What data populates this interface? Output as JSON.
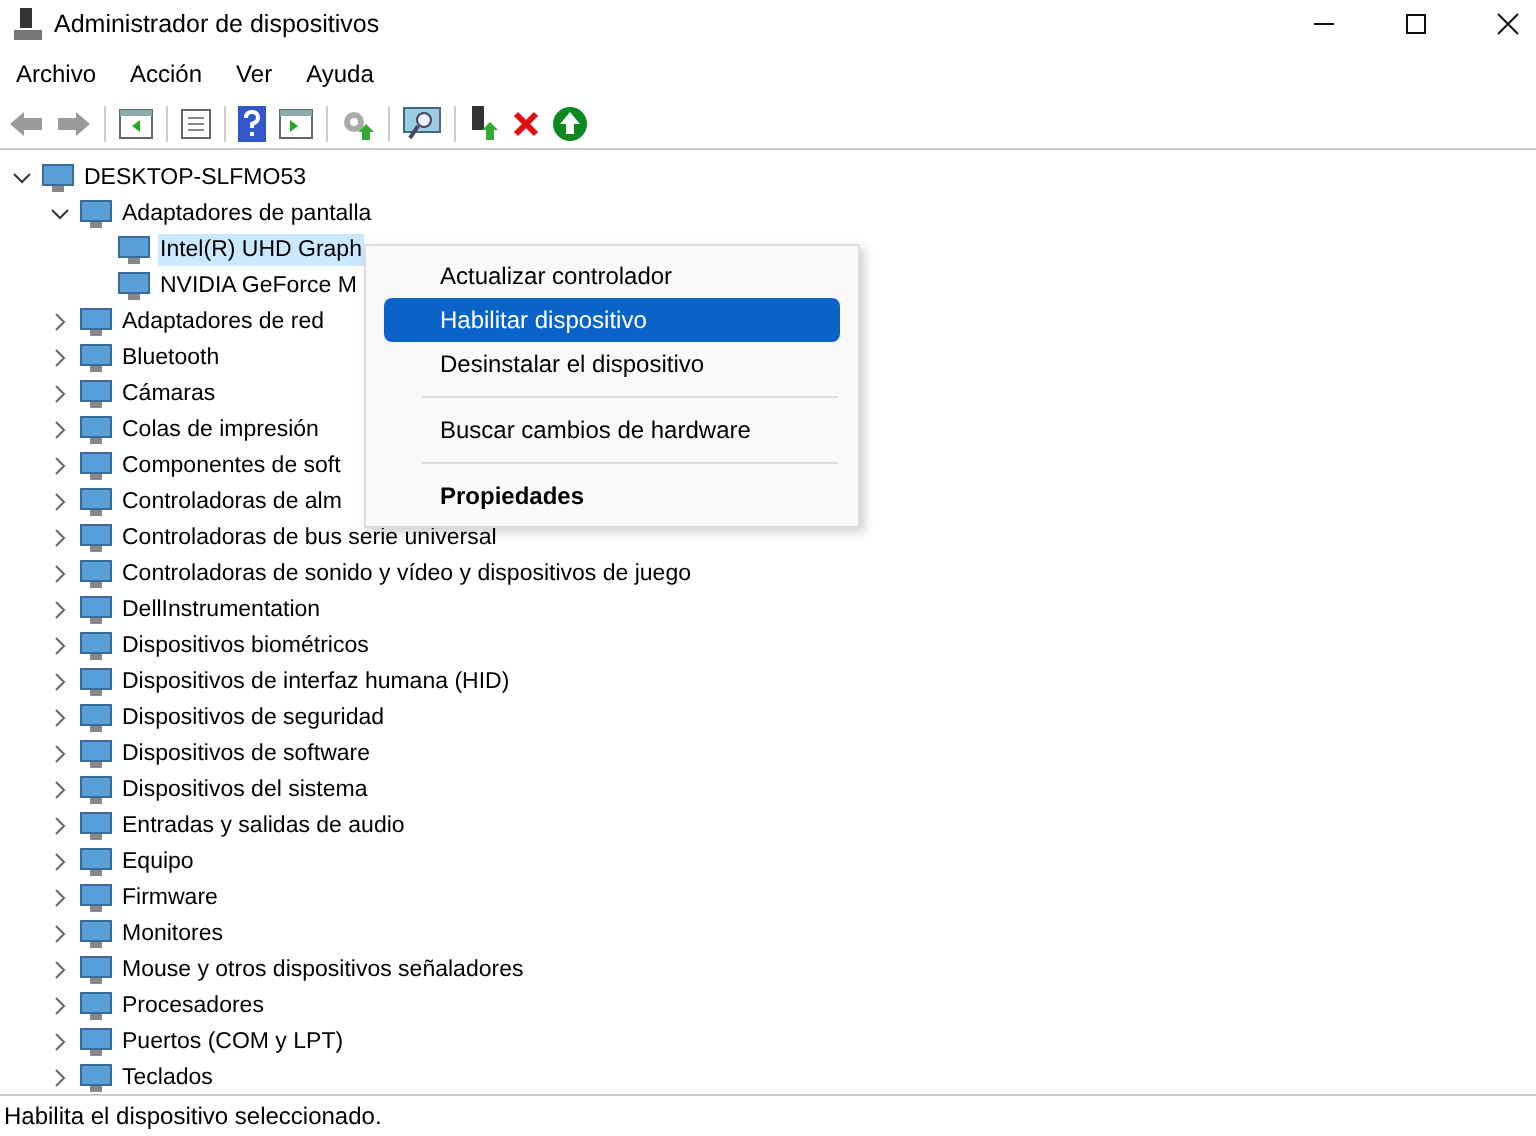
{
  "window": {
    "title": "Administrador de dispositivos"
  },
  "menu_bar": [
    "Archivo",
    "Acción",
    "Ver",
    "Ayuda"
  ],
  "tree": [
    {
      "label": "DESKTOP-SLFMO53",
      "expanded": true,
      "selected": false,
      "children": [
        {
          "label": "Adaptadores de pantalla",
          "expanded": true,
          "selected": false,
          "children": [
            {
              "label": "Intel(R) UHD Graph",
              "selected": true
            },
            {
              "label": "NVIDIA GeForce M",
              "selected": false
            }
          ]
        },
        {
          "label": "Adaptadores de red",
          "expanded": false,
          "selected": false
        },
        {
          "label": "Bluetooth",
          "expanded": false,
          "selected": false
        },
        {
          "label": "Cámaras",
          "expanded": false,
          "selected": false
        },
        {
          "label": "Colas de impresión",
          "expanded": false,
          "selected": false
        },
        {
          "label": "Componentes de soft",
          "expanded": false,
          "selected": false
        },
        {
          "label": "Controladoras de alm",
          "expanded": false,
          "selected": false
        },
        {
          "label": "Controladoras de bus serie universal",
          "expanded": false,
          "selected": false
        },
        {
          "label": "Controladoras de sonido y vídeo y dispositivos de juego",
          "expanded": false,
          "selected": false
        },
        {
          "label": "DellInstrumentation",
          "expanded": false,
          "selected": false
        },
        {
          "label": "Dispositivos biométricos",
          "expanded": false,
          "selected": false
        },
        {
          "label": "Dispositivos de interfaz humana (HID)",
          "expanded": false,
          "selected": false
        },
        {
          "label": "Dispositivos de seguridad",
          "expanded": false,
          "selected": false
        },
        {
          "label": "Dispositivos de software",
          "expanded": false,
          "selected": false
        },
        {
          "label": "Dispositivos del sistema",
          "expanded": false,
          "selected": false
        },
        {
          "label": "Entradas y salidas de audio",
          "expanded": false,
          "selected": false
        },
        {
          "label": "Equipo",
          "expanded": false,
          "selected": false
        },
        {
          "label": "Firmware",
          "expanded": false,
          "selected": false
        },
        {
          "label": "Monitores",
          "expanded": false,
          "selected": false
        },
        {
          "label": "Mouse y otros dispositivos señaladores",
          "expanded": false,
          "selected": false
        },
        {
          "label": "Procesadores",
          "expanded": false,
          "selected": false
        },
        {
          "label": "Puertos (COM y LPT)",
          "expanded": false,
          "selected": false
        },
        {
          "label": "Teclados",
          "expanded": false,
          "selected": false
        }
      ]
    }
  ],
  "context_menu": [
    {
      "kind": "item",
      "label": "Actualizar controlador",
      "selected": false,
      "default": false
    },
    {
      "kind": "item",
      "label": "Habilitar dispositivo",
      "selected": true,
      "default": false
    },
    {
      "kind": "item",
      "label": "Desinstalar el dispositivo",
      "selected": false,
      "default": false
    },
    {
      "kind": "separator"
    },
    {
      "kind": "item",
      "label": "Buscar cambios de hardware",
      "selected": false,
      "default": false
    },
    {
      "kind": "separator"
    },
    {
      "kind": "item",
      "label": "Propiedades",
      "selected": false,
      "default": true
    }
  ],
  "status_bar": "Habilita el dispositivo seleccionado."
}
